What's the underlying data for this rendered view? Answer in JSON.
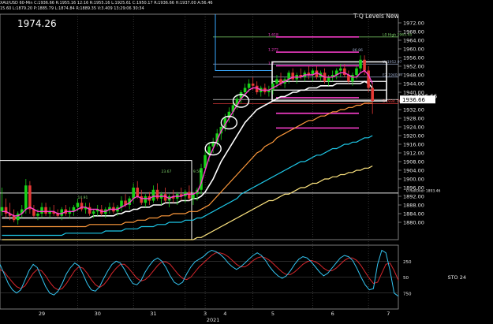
{
  "header": {
    "line1": "XAU/USD 60-Min  C:1936.66  R:1955.16  12:16  R:1955.16  L:1925.61  C:1950.17  R:1936.66  H:1937.00  A:56.46",
    "line2": "15.60  L:1879.20  P:1885.79  L:1874.84  R:1889.35  V:3.409  13:29:06  30:34",
    "big_price": "1974.26",
    "title": "T-Q Levels New"
  },
  "colors": {
    "background": "#000000",
    "candle_up": "#19d219",
    "candle_down": "#e53935",
    "magenta": "#ff3fd1",
    "white_ma": "#ffffff",
    "orange_ma": "#ff9a3c",
    "cyan_ma": "#1ec8e8",
    "yellow_ma": "#ffe680",
    "sto_fast": "#33c4f0",
    "sto_slow": "#d8262c"
  },
  "chart_data": {
    "type": "line",
    "price_axis": {
      "ylim": [
        1872,
        1976
      ],
      "ticks": [
        1972,
        1964,
        1956,
        1948,
        1940,
        1932,
        1924,
        1916,
        1908,
        1900,
        1892,
        1884,
        1876
      ],
      "tick_labels": [
        "1972.00",
        "1968.00",
        "1964.00",
        "1960.00",
        "1956.00",
        "1952.00",
        "1948.00",
        "1944.00",
        "1940.00",
        "1936.00",
        "1932.00",
        "1928.00",
        "1924.00",
        "1920.00",
        "1916.00",
        "1912.00",
        "1908.00",
        "1904.00",
        "1900.00",
        "1896.00",
        "1892.00",
        "1888.00",
        "1884.00",
        "1880.00"
      ],
      "tick_values": [
        1972,
        1968,
        1964,
        1960,
        1956,
        1952,
        1948,
        1944,
        1940,
        1936,
        1932,
        1928,
        1924,
        1920,
        1916,
        1912,
        1908,
        1904,
        1900,
        1896,
        1892,
        1888,
        1884,
        1880
      ],
      "current_price_label": "1936.66",
      "current_price": 1936.66
    },
    "x_axis": {
      "labels": [
        "29",
        "30",
        "31",
        "3",
        "4",
        "5",
        "6",
        "7"
      ],
      "label_x_index": [
        10,
        24,
        38,
        51,
        56,
        68,
        83,
        97
      ],
      "year_label": "2021",
      "n_bars": 100
    },
    "levels": [
      {
        "label": "L0 High 1965.45",
        "value": 1965.5,
        "color": "#7fd36b"
      },
      {
        "label": "W 1952.97",
        "value": 1953.0,
        "color": "#9aa9c8"
      },
      {
        "label": "E2 1940.77",
        "value": 1947.0,
        "color": "#9aa9c8"
      },
      {
        "label": "< 1936.66",
        "value": 1936.66,
        "color": "#ffffff"
      },
      {
        "label": "S 1934.71",
        "value": 1934.7,
        "color": "#ff4444"
      },
      {
        "label": "0 RollOver 1893.46",
        "value": 1893.5,
        "color": "#e8e8e8"
      }
    ],
    "pink_levels": [
      1965.5,
      1958.5,
      1952.2,
      1937.5,
      1930.3,
      1923.5
    ],
    "pink_labels": [
      "1.618",
      "1.272",
      "1.0",
      "",
      "",
      ""
    ],
    "annotations": [
      "23.67",
      "9.59",
      "14.91",
      "86.86"
    ],
    "candles": [
      [
        1885,
        1896,
        1883,
        1887
      ],
      [
        1887,
        1891,
        1882,
        1884
      ],
      [
        1884,
        1889,
        1881,
        1883
      ],
      [
        1883,
        1886,
        1880,
        1881
      ],
      [
        1881,
        1885,
        1879,
        1884
      ],
      [
        1884,
        1888,
        1882,
        1886
      ],
      [
        1886,
        1900,
        1884,
        1897
      ],
      [
        1897,
        1899,
        1884,
        1886
      ],
      [
        1886,
        1888,
        1882,
        1883
      ],
      [
        1883,
        1886,
        1881,
        1884
      ],
      [
        1884,
        1889,
        1882,
        1887
      ],
      [
        1887,
        1889,
        1883,
        1884
      ],
      [
        1884,
        1887,
        1882,
        1885
      ],
      [
        1885,
        1888,
        1883,
        1884
      ],
      [
        1884,
        1886,
        1882,
        1883
      ],
      [
        1883,
        1887,
        1881,
        1886
      ],
      [
        1886,
        1888,
        1883,
        1884
      ],
      [
        1884,
        1887,
        1882,
        1885
      ],
      [
        1885,
        1888,
        1883,
        1887
      ],
      [
        1887,
        1891,
        1885,
        1889
      ],
      [
        1889,
        1891,
        1885,
        1886
      ],
      [
        1886,
        1889,
        1884,
        1887
      ],
      [
        1887,
        1889,
        1883,
        1884
      ],
      [
        1884,
        1886,
        1882,
        1885
      ],
      [
        1885,
        1888,
        1883,
        1886
      ],
      [
        1886,
        1888,
        1883,
        1884
      ],
      [
        1884,
        1887,
        1882,
        1886
      ],
      [
        1886,
        1889,
        1884,
        1887
      ],
      [
        1887,
        1889,
        1884,
        1885
      ],
      [
        1885,
        1888,
        1883,
        1887
      ],
      [
        1887,
        1892,
        1885,
        1890
      ],
      [
        1890,
        1893,
        1887,
        1888
      ],
      [
        1888,
        1892,
        1886,
        1891
      ],
      [
        1891,
        1898,
        1889,
        1896
      ],
      [
        1896,
        1899,
        1891,
        1892
      ],
      [
        1892,
        1895,
        1888,
        1889
      ],
      [
        1889,
        1893,
        1887,
        1892
      ],
      [
        1892,
        1894,
        1888,
        1890
      ],
      [
        1890,
        1897,
        1889,
        1895
      ],
      [
        1895,
        1898,
        1890,
        1891
      ],
      [
        1891,
        1894,
        1888,
        1893
      ],
      [
        1893,
        1896,
        1889,
        1890
      ],
      [
        1890,
        1893,
        1887,
        1892
      ],
      [
        1892,
        1895,
        1889,
        1891
      ],
      [
        1891,
        1894,
        1888,
        1893
      ],
      [
        1893,
        1896,
        1890,
        1892
      ],
      [
        1892,
        1895,
        1889,
        1894
      ],
      [
        1894,
        1897,
        1890,
        1891
      ],
      [
        1891,
        1894,
        1888,
        1893
      ],
      [
        1893,
        1896,
        1890,
        1895
      ],
      [
        1895,
        1907,
        1893,
        1905
      ],
      [
        1905,
        1913,
        1903,
        1911
      ],
      [
        1911,
        1917,
        1908,
        1915
      ],
      [
        1915,
        1919,
        1912,
        1917
      ],
      [
        1917,
        1923,
        1915,
        1921
      ],
      [
        1921,
        1926,
        1918,
        1924
      ],
      [
        1924,
        1930,
        1922,
        1928
      ],
      [
        1928,
        1933,
        1926,
        1931
      ],
      [
        1931,
        1936,
        1929,
        1934
      ],
      [
        1934,
        1939,
        1932,
        1937
      ],
      [
        1937,
        1941,
        1935,
        1940
      ],
      [
        1940,
        1944,
        1938,
        1942
      ],
      [
        1942,
        1946,
        1940,
        1944
      ],
      [
        1944,
        1947,
        1941,
        1943
      ],
      [
        1943,
        1945,
        1939,
        1940
      ],
      [
        1940,
        1943,
        1938,
        1942
      ],
      [
        1942,
        1944,
        1939,
        1940
      ],
      [
        1940,
        1943,
        1938,
        1941
      ],
      [
        1941,
        1945,
        1939,
        1944
      ],
      [
        1944,
        1948,
        1942,
        1946
      ],
      [
        1946,
        1949,
        1943,
        1944
      ],
      [
        1944,
        1947,
        1942,
        1946
      ],
      [
        1946,
        1950,
        1944,
        1949
      ],
      [
        1949,
        1951,
        1945,
        1946
      ],
      [
        1946,
        1949,
        1944,
        1948
      ],
      [
        1948,
        1951,
        1946,
        1947
      ],
      [
        1947,
        1950,
        1945,
        1949
      ],
      [
        1949,
        1952,
        1946,
        1948
      ],
      [
        1948,
        1951,
        1945,
        1950
      ],
      [
        1950,
        1952,
        1946,
        1947
      ],
      [
        1947,
        1950,
        1945,
        1949
      ],
      [
        1949,
        1951,
        1944,
        1945
      ],
      [
        1945,
        1948,
        1943,
        1947
      ],
      [
        1947,
        1950,
        1945,
        1948
      ],
      [
        1948,
        1951,
        1946,
        1950
      ],
      [
        1950,
        1953,
        1947,
        1951
      ],
      [
        1951,
        1953,
        1947,
        1948
      ],
      [
        1948,
        1950,
        1944,
        1945
      ],
      [
        1945,
        1949,
        1943,
        1948
      ],
      [
        1948,
        1952,
        1946,
        1951
      ],
      [
        1951,
        1957,
        1949,
        1955
      ],
      [
        1955,
        1957,
        1948,
        1950
      ],
      [
        1950,
        1952,
        1940,
        1942
      ],
      [
        1942,
        1944,
        1930,
        1936
      ]
    ],
    "magenta_ma": [
      1885,
      1885,
      1884,
      1883,
      1883,
      1884,
      1886,
      1887,
      1886,
      1885,
      1885,
      1885,
      1885,
      1885,
      1884,
      1884,
      1885,
      1885,
      1885,
      1886,
      1887,
      1887,
      1886,
      1886,
      1886,
      1885,
      1885,
      1886,
      1886,
      1886,
      1887,
      1888,
      1889,
      1891,
      1892,
      1891,
      1891,
      1891,
      1892,
      1892,
      1892,
      1892,
      1891,
      1892,
      1892,
      1892,
      1893,
      1893,
      1893,
      1894,
      1898,
      1904,
      1910,
      1914,
      1918,
      1922,
      1925,
      1928,
      1931,
      1934,
      1937,
      1939,
      1941,
      1942,
      1942,
      1941,
      1941,
      1941,
      1942,
      1943,
      1944,
      1945,
      1946,
      1947,
      1947,
      1947,
      1948,
      1948,
      1948,
      1949,
      1948,
      1947,
      1947,
      1947,
      1948,
      1949,
      1949,
      1948,
      1947,
      1947,
      1949,
      1950,
      1948,
      1944
    ],
    "white_ma": [
      1882,
      1882,
      1882,
      1882,
      1882,
      1882,
      1882,
      1882,
      1882,
      1882,
      1882,
      1882,
      1882,
      1882,
      1882,
      1882,
      1882,
      1882,
      1882,
      1882,
      1882,
      1882,
      1882,
      1883,
      1883,
      1883,
      1883,
      1883,
      1883,
      1884,
      1884,
      1885,
      1885,
      1886,
      1886,
      1887,
      1887,
      1887,
      1888,
      1888,
      1888,
      1889,
      1889,
      1889,
      1889,
      1890,
      1890,
      1890,
      1891,
      1891,
      1892,
      1894,
      1897,
      1900,
      1904,
      1908,
      1911,
      1914,
      1917,
      1920,
      1923,
      1926,
      1928,
      1930,
      1932,
      1933,
      1934,
      1935,
      1936,
      1937,
      1938,
      1938,
      1939,
      1940,
      1940,
      1941,
      1941,
      1942,
      1942,
      1942,
      1943,
      1943,
      1943,
      1943,
      1944,
      1944,
      1944,
      1944,
      1944,
      1944,
      1944,
      1945,
      1944,
      1942
    ],
    "orange_ma": [
      1878,
      1878,
      1878,
      1878,
      1878,
      1878,
      1878,
      1878,
      1878,
      1878,
      1878,
      1878,
      1878,
      1878,
      1878,
      1878,
      1878,
      1878,
      1878,
      1878,
      1878,
      1878,
      1879,
      1879,
      1879,
      1879,
      1879,
      1879,
      1879,
      1879,
      1879,
      1880,
      1880,
      1880,
      1881,
      1881,
      1881,
      1882,
      1882,
      1882,
      1883,
      1883,
      1883,
      1884,
      1884,
      1884,
      1884,
      1885,
      1885,
      1885,
      1886,
      1887,
      1888,
      1890,
      1892,
      1894,
      1896,
      1898,
      1900,
      1902,
      1904,
      1906,
      1908,
      1910,
      1912,
      1913,
      1915,
      1916,
      1917,
      1919,
      1920,
      1921,
      1922,
      1923,
      1924,
      1925,
      1926,
      1927,
      1927,
      1928,
      1929,
      1929,
      1930,
      1931,
      1931,
      1932,
      1932,
      1933,
      1933,
      1934,
      1934,
      1935,
      1935,
      1935
    ],
    "cyan_ma": [
      1874,
      1874,
      1874,
      1874,
      1874,
      1874,
      1874,
      1874,
      1874,
      1874,
      1874,
      1874,
      1874,
      1874,
      1874,
      1874,
      1875,
      1875,
      1875,
      1875,
      1875,
      1875,
      1875,
      1875,
      1875,
      1875,
      1876,
      1876,
      1876,
      1876,
      1876,
      1877,
      1877,
      1877,
      1877,
      1878,
      1878,
      1878,
      1878,
      1879,
      1879,
      1879,
      1880,
      1880,
      1880,
      1880,
      1881,
      1881,
      1881,
      1882,
      1882,
      1883,
      1884,
      1885,
      1886,
      1887,
      1888,
      1889,
      1890,
      1891,
      1893,
      1894,
      1895,
      1896,
      1897,
      1898,
      1899,
      1900,
      1901,
      1902,
      1903,
      1904,
      1905,
      1906,
      1907,
      1908,
      1908,
      1909,
      1910,
      1911,
      1911,
      1912,
      1913,
      1914,
      1914,
      1915,
      1916,
      1916,
      1917,
      1917,
      1918,
      1919,
      1919,
      1920
    ],
    "yellow_ma": [
      1872,
      1872,
      1872,
      1872,
      1872,
      1872,
      1872,
      1872,
      1872,
      1872,
      1872,
      1872,
      1872,
      1872,
      1872,
      1872,
      1872,
      1872,
      1872,
      1872,
      1872,
      1872,
      1872,
      1872,
      1872,
      1872,
      1872,
      1872,
      1872,
      1872,
      1872,
      1872,
      1872,
      1872,
      1872,
      1872,
      1872,
      1872,
      1872,
      1872,
      1872,
      1872,
      1872,
      1872,
      1872,
      1872,
      1872,
      1872,
      1872,
      1873,
      1873,
      1874,
      1875,
      1876,
      1877,
      1878,
      1879,
      1880,
      1881,
      1882,
      1883,
      1884,
      1885,
      1886,
      1887,
      1888,
      1889,
      1890,
      1890,
      1891,
      1892,
      1893,
      1893,
      1894,
      1895,
      1896,
      1896,
      1897,
      1898,
      1898,
      1899,
      1900,
      1900,
      1901,
      1901,
      1902,
      1902,
      1903,
      1903,
      1904,
      1904,
      1905,
      1905,
      1906
    ],
    "stochastic": {
      "label": "STO 24",
      "ylim": [
        0,
        100
      ],
      "tick_labels": [
        "250",
        "50",
        "750"
      ],
      "tick_values": [
        75,
        50,
        25
      ],
      "fast": [
        70,
        55,
        40,
        30,
        25,
        30,
        45,
        60,
        70,
        65,
        50,
        35,
        25,
        22,
        28,
        40,
        55,
        65,
        72,
        68,
        55,
        40,
        30,
        28,
        35,
        48,
        60,
        70,
        75,
        72,
        62,
        50,
        40,
        38,
        45,
        58,
        68,
        76,
        80,
        75,
        65,
        52,
        42,
        38,
        42,
        55,
        66,
        74,
        78,
        82,
        88,
        92,
        90,
        86,
        80,
        72,
        66,
        62,
        66,
        72,
        78,
        84,
        88,
        84,
        76,
        66,
        58,
        52,
        48,
        52,
        60,
        70,
        78,
        82,
        80,
        74,
        66,
        58,
        52,
        56,
        64,
        72,
        80,
        84,
        82,
        76,
        64,
        50,
        38,
        30,
        32,
        70,
        92,
        88,
        60,
        25,
        20
      ],
      "slow": [
        62,
        58,
        50,
        42,
        35,
        32,
        36,
        46,
        56,
        62,
        60,
        52,
        42,
        34,
        30,
        32,
        40,
        50,
        60,
        66,
        64,
        56,
        46,
        38,
        34,
        38,
        46,
        56,
        64,
        70,
        70,
        64,
        56,
        48,
        44,
        46,
        52,
        60,
        68,
        74,
        74,
        70,
        62,
        54,
        48,
        46,
        50,
        58,
        66,
        72,
        78,
        84,
        88,
        88,
        86,
        82,
        76,
        70,
        66,
        66,
        70,
        76,
        80,
        82,
        80,
        76,
        70,
        64,
        58,
        54,
        54,
        58,
        64,
        70,
        74,
        76,
        74,
        70,
        64,
        60,
        60,
        64,
        70,
        76,
        80,
        80,
        76,
        68,
        58,
        48,
        40,
        42,
        56,
        70,
        72,
        60,
        45
      ]
    }
  }
}
